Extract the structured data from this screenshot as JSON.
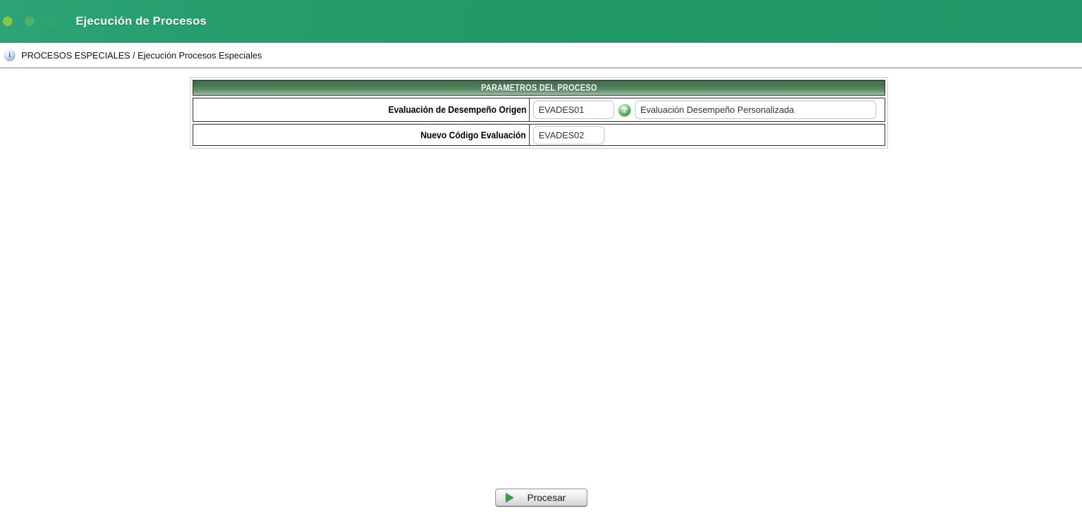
{
  "header": {
    "title": "Ejecución de Procesos",
    "bg_color": "#1F9867",
    "dot_colors": [
      "#8AC44B",
      "#4EB269",
      "#35A470"
    ]
  },
  "breadcrumb": {
    "icon_glyph": "i",
    "text": "PROCESOS ESPECIALES / Ejecución Procesos Especiales"
  },
  "form": {
    "title": "PARAMETROS DEL PROCESO",
    "header_gradient": {
      "top": "#3F6E4B",
      "bottom": "#A4C3AB"
    },
    "rows": [
      {
        "label": "Evaluación de Desempeño Origen",
        "code_value": "EVADES01",
        "help_icon_glyph": "?",
        "help_icon_color": "#2F9A4F",
        "description_value": "Evaluación Desempeño Personalizada"
      },
      {
        "label": "Nuevo Código Evaluación",
        "code_value": "EVADES02"
      }
    ]
  },
  "actions": {
    "process_label": "Procesar",
    "play_icon_color": "#35A33B"
  }
}
